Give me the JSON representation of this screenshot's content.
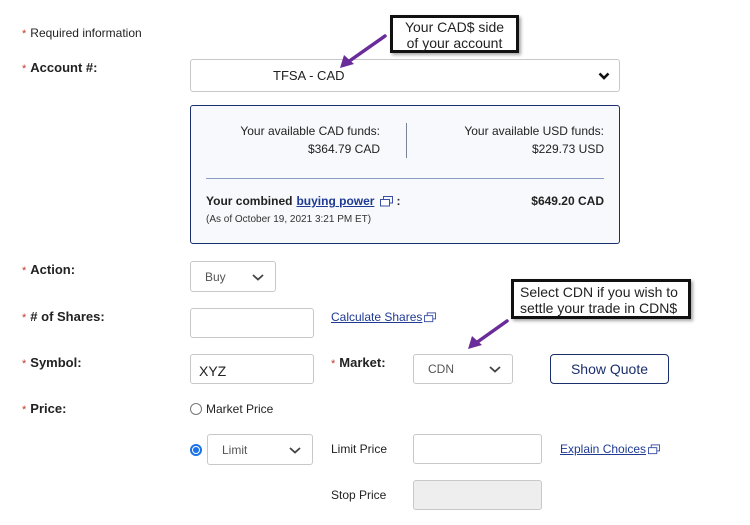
{
  "required_info": "Required information",
  "required_marker": "*",
  "account": {
    "label": "Account #:",
    "value": "TFSA - CAD"
  },
  "callouts": {
    "account_note": [
      "Your CAD$ side",
      "of your account"
    ],
    "market_note": [
      "Select CDN if you wish to",
      "settle your trade in CDN$"
    ]
  },
  "funds": {
    "cad_label": "Your available CAD funds:",
    "cad_value": "$364.79 CAD",
    "usd_label": "Your available USD funds:",
    "usd_value": "$229.73 USD",
    "combined_prefix": "Your combined",
    "combined_link": "buying power",
    "combined_suffix": ":",
    "combined_value": "$649.20 CAD",
    "as_of": "(As of October 19, 2021 3:21 PM ET)"
  },
  "action": {
    "label": "Action:",
    "value": "Buy"
  },
  "shares": {
    "label": "# of Shares:",
    "value": "",
    "calc_link": "Calculate Shares"
  },
  "symbol": {
    "label": "Symbol:",
    "value": "XYZ"
  },
  "market": {
    "label": "Market:",
    "value": "CDN"
  },
  "show_quote": "Show Quote",
  "price": {
    "label": "Price:",
    "market_price_option": "Market Price",
    "limit_type_value": "Limit",
    "selected": "limit",
    "limit_price_label": "Limit Price",
    "limit_price_value": "",
    "stop_price_label": "Stop Price",
    "stop_price_value": "",
    "explain_link": "Explain Choices"
  },
  "colors": {
    "accent": "#1a2f6b",
    "link": "#1f3a93",
    "required": "#c0392b",
    "arrow": "#6a2c9a",
    "radio": "#1a73e8"
  }
}
